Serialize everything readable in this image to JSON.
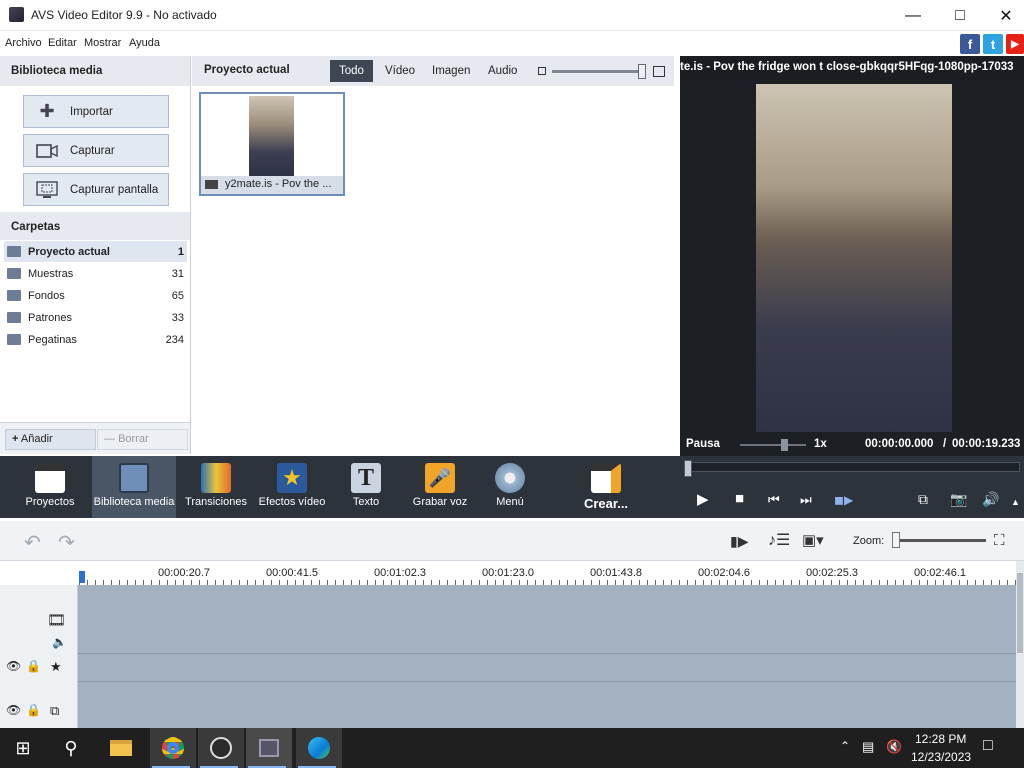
{
  "window": {
    "title": "AVS Video Editor 9.9 - No activado"
  },
  "menu": [
    "Archivo",
    "Editar",
    "Mostrar",
    "Ayuda"
  ],
  "social": [
    "f",
    "t",
    "▶"
  ],
  "media_library": {
    "header": "Biblioteca media",
    "buttons": [
      "Importar",
      "Capturar",
      "Capturar pantalla"
    ],
    "folders_header": "Carpetas",
    "folders": [
      {
        "name": "Proyecto actual",
        "count": "1"
      },
      {
        "name": "Muestras",
        "count": "31"
      },
      {
        "name": "Fondos",
        "count": "65"
      },
      {
        "name": "Patrones",
        "count": "33"
      },
      {
        "name": "Pegatinas",
        "count": "234"
      }
    ],
    "add_label": "Añadir",
    "delete_label": "Borrar"
  },
  "media_area": {
    "header": "Proyecto actual",
    "tabs": [
      "Todo",
      "Vídeo",
      "Imagen",
      "Audio"
    ],
    "items": [
      {
        "label": "y2mate.is - Pov the ..."
      }
    ]
  },
  "preview": {
    "title": "te.is - Pov the fridge won t close-gbkqqr5HFqg-1080pp-17033",
    "state": "Pausa",
    "speed": "1x",
    "time_current": "00:00:00.000",
    "time_sep": "/",
    "time_total": "00:00:19.233"
  },
  "toolbar": [
    {
      "label": "Proyectos",
      "icon": "clapper-icon"
    },
    {
      "label": "Biblioteca media",
      "icon": "film-icon"
    },
    {
      "label": "Transiciones",
      "icon": "transition-icon"
    },
    {
      "label": "Efectos vídeo",
      "icon": "star-icon"
    },
    {
      "label": "Texto",
      "icon": "text-icon"
    },
    {
      "label": "Grabar voz",
      "icon": "microphone-icon"
    },
    {
      "label": "Menú",
      "icon": "disc-icon"
    },
    {
      "label": "Crear...",
      "icon": "create-icon"
    }
  ],
  "timeline": {
    "zoom_label": "Zoom:",
    "ticks": [
      "00:00:20.7",
      "00:00:41.5",
      "00:01:02.3",
      "00:01:23.0",
      "00:01:43.8",
      "00:02:04.6",
      "00:02:25.3",
      "00:02:46.1"
    ]
  },
  "taskbar": {
    "time": "12:28 PM",
    "date": "12/23/2023"
  }
}
